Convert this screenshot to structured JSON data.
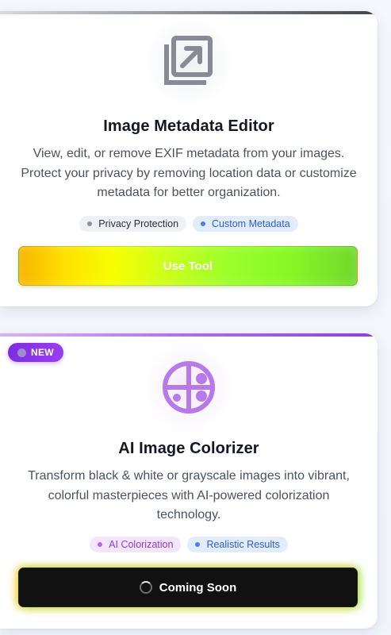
{
  "cards": [
    {
      "title": "Image Metadata Editor",
      "description": "View, edit, or remove EXIF metadata from your images. Protect your privacy by removing location data or customize metadata for better organization.",
      "icon": "image-export-icon",
      "tags": [
        "Privacy Protection",
        "Custom Metadata"
      ],
      "button_label": "Use Tool"
    },
    {
      "badge": "NEW",
      "title": "AI Image Colorizer",
      "description": "Transform black & white or grayscale images into vibrant, colorful masterpieces with AI-powered colorization technology.",
      "icon": "palette-icon",
      "tags": [
        "AI Colorization",
        "Realistic Results"
      ],
      "button_label": "Coming Soon"
    }
  ],
  "colors": {
    "title": "#141826",
    "description": "#4c5263",
    "icon_gray": "#888b94",
    "icon_purple": "#b87ae8",
    "badge_purple": "#8a35e8"
  }
}
